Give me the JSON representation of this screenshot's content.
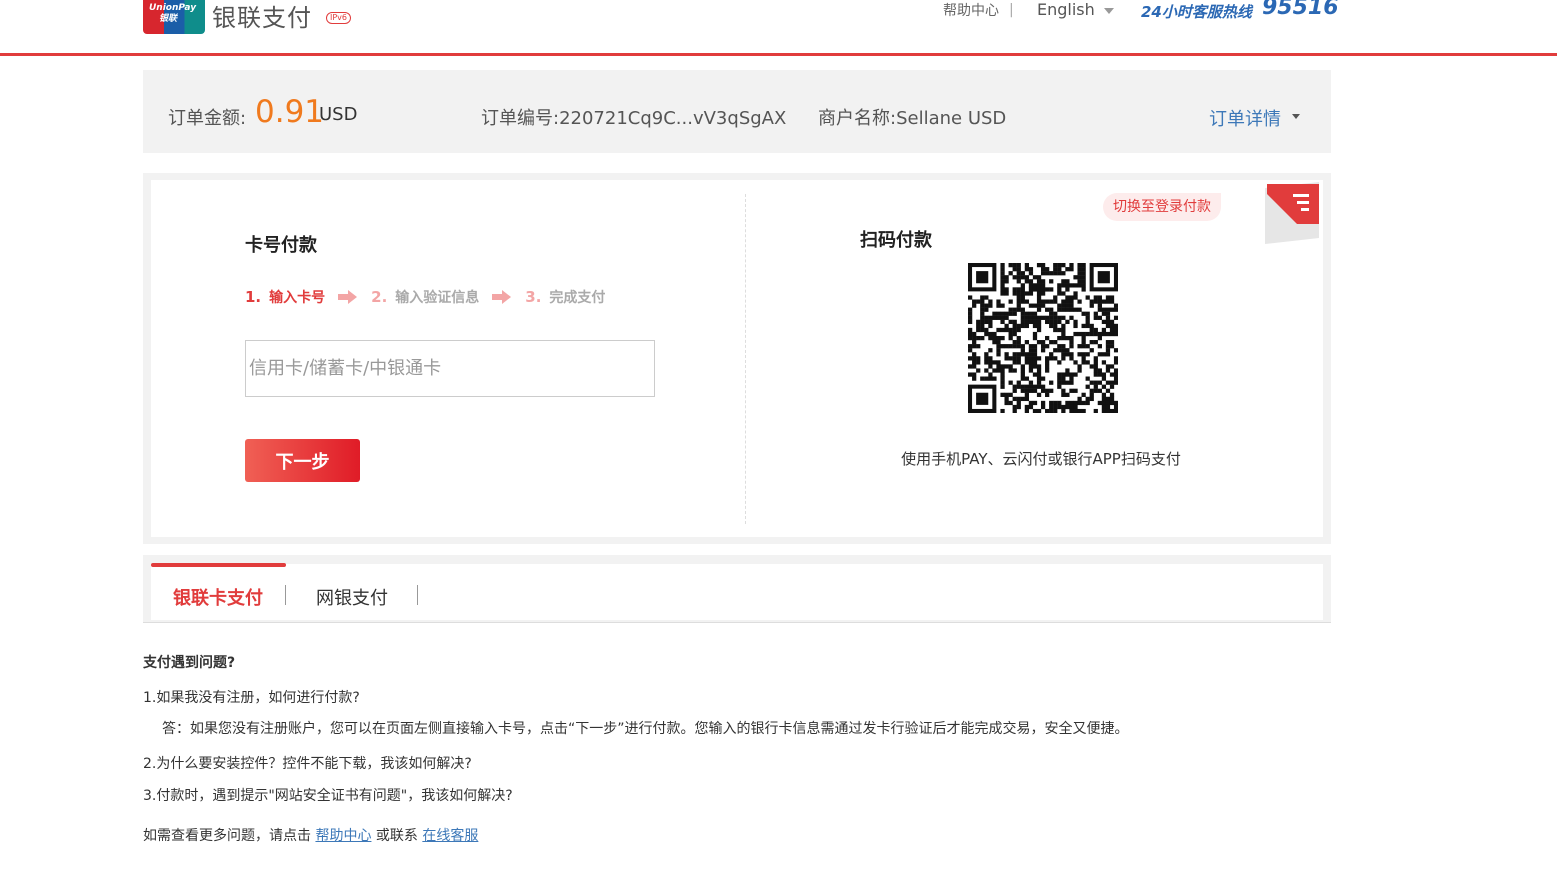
{
  "header": {
    "logo_text": "UnionPay",
    "logo_text_cn": "银联",
    "brand": "银联支付",
    "ipv6_badge": "IPv6",
    "help_link": "帮助中心",
    "separator": "|",
    "language": "English",
    "hotline_label": "24小时客服热线",
    "hotline_number": "95516"
  },
  "order": {
    "amount_label": "订单金额:",
    "amount": "0.91",
    "currency": "USD",
    "order_no_label": "订单编号:",
    "order_no": "220721Cq9C...vV3qSgAX",
    "merchant_label": "商户名称:",
    "merchant": "Sellane USD",
    "detail_link": "订单详情"
  },
  "card_pay": {
    "title": "卡号付款",
    "steps": [
      {
        "num": "1.",
        "label": "输入卡号"
      },
      {
        "num": "2.",
        "label": "输入验证信息"
      },
      {
        "num": "3.",
        "label": "完成支付"
      }
    ],
    "input_placeholder": "信用卡/储蓄卡/中银通卡",
    "next_button": "下一步"
  },
  "qr_pay": {
    "title": "扫码付款",
    "caption": "使用手机PAY、云闪付或银行APP扫码支付",
    "switch_tip": "切换至登录付款"
  },
  "tabs": [
    {
      "label": "银联卡支付"
    },
    {
      "label": "网银支付"
    }
  ],
  "faq": {
    "title": "支付遇到问题?",
    "q1": "1.如果我没有注册，如何进行付款?",
    "a1": "答：如果您没有注册账户，您可以在页面左侧直接输入卡号，点击“下一步”进行付款。您输入的银行卡信息需通过发卡行验证后才能完成交易，安全又便捷。",
    "q2": "2.为什么要安装控件？控件不能下载，我该如何解决?",
    "q3": "3.付款时，遇到提示\"网站安全证书有问题\"，我该如何解决?",
    "more_prefix": "如需查看更多问题，请点击",
    "more_help_link": "帮助中心",
    "more_middle": "或联系",
    "more_service_link": "在线客服"
  },
  "colors": {
    "accent_red": "#e13c3c",
    "amount_orange": "#f07a1e",
    "link_blue": "#3d78b8"
  }
}
